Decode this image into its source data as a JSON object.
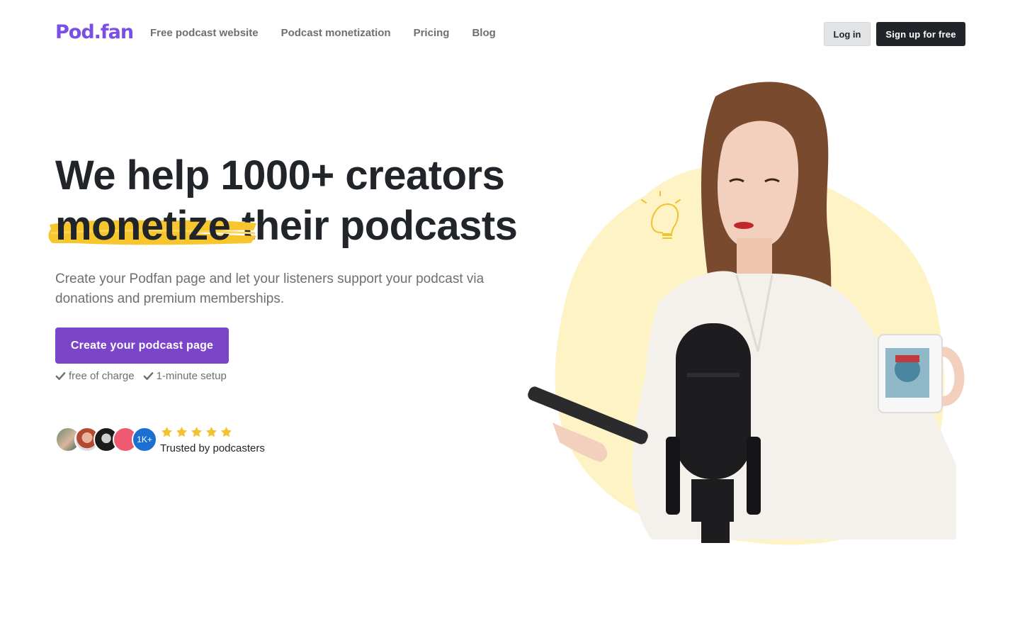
{
  "header": {
    "logo": "Pod.fan",
    "nav": [
      "Free podcast website",
      "Podcast monetization",
      "Pricing",
      "Blog"
    ],
    "login_label": "Log in",
    "signup_label": "Sign up for free"
  },
  "hero": {
    "headline_line1": "We help 1000+ creators",
    "headline_highlight": "monetize",
    "headline_rest": " their podcasts",
    "subtext": "Create your Podfan page and let your listeners support your podcast via donations and premium memberships.",
    "cta_label": "Create your podcast page",
    "features": [
      "free of charge",
      "1-minute setup"
    ]
  },
  "proof": {
    "count_badge": "1K+",
    "stars": 5,
    "label": "Trusted by podcasters"
  },
  "colors": {
    "brand": "#7b4ee8",
    "cta": "#7b45c9",
    "highlight": "#f7c52c",
    "dark": "#212529",
    "blob": "#fdf3c4"
  },
  "icons": [
    "check-icon",
    "star-icon",
    "lightbulb-icon"
  ]
}
